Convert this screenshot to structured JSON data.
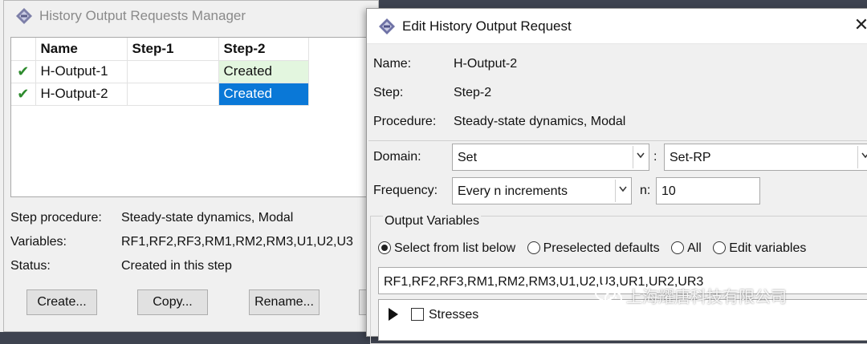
{
  "manager": {
    "title": "History Output Requests Manager",
    "columns": [
      "",
      "Name",
      "Step-1",
      "Step-2"
    ],
    "rows": [
      {
        "check": "✔",
        "name": "H-Output-1",
        "step1": "",
        "step2": "Created"
      },
      {
        "check": "✔",
        "name": "H-Output-2",
        "step1": "",
        "step2": "Created"
      }
    ],
    "info": {
      "procedure_label": "Step procedure:",
      "procedure_value": "Steady-state dynamics, Modal",
      "variables_label": "Variables:",
      "variables_value": "RF1,RF2,RF3,RM1,RM2,RM3,U1,U2,U3",
      "status_label": "Status:",
      "status_value": "Created in this step"
    },
    "buttons": {
      "create": "Create...",
      "copy": "Copy...",
      "rename": "Rename..."
    }
  },
  "edit": {
    "title": "Edit History Output Request",
    "name_label": "Name:",
    "name_value": "H-Output-2",
    "step_label": "Step:",
    "step_value": "Step-2",
    "procedure_label": "Procedure:",
    "procedure_value": "Steady-state dynamics, Modal",
    "domain_label": "Domain:",
    "domain_value": "Set",
    "domain_sep": ":",
    "set_value": "Set-RP",
    "frequency_label": "Frequency:",
    "frequency_value": "Every n increments",
    "n_label": "n:",
    "n_value": "10",
    "output_variables_title": "Output Variables",
    "radio_options": [
      "Select from list below",
      "Preselected defaults",
      "All",
      "Edit variables"
    ],
    "selected_radio_index": 0,
    "variables_text": "RF1,RF2,RF3,RM1,RM2,RM3,U1,U2,U3,UR1,UR2,UR3",
    "tree_first_item": "Stresses"
  },
  "watermark": {
    "text": "上海耀唐科技有限公司",
    "icon": "wechat-icon"
  },
  "colors": {
    "selected": "#0a78d7",
    "created": "#e3f6df",
    "check": "#2e8b2e"
  }
}
